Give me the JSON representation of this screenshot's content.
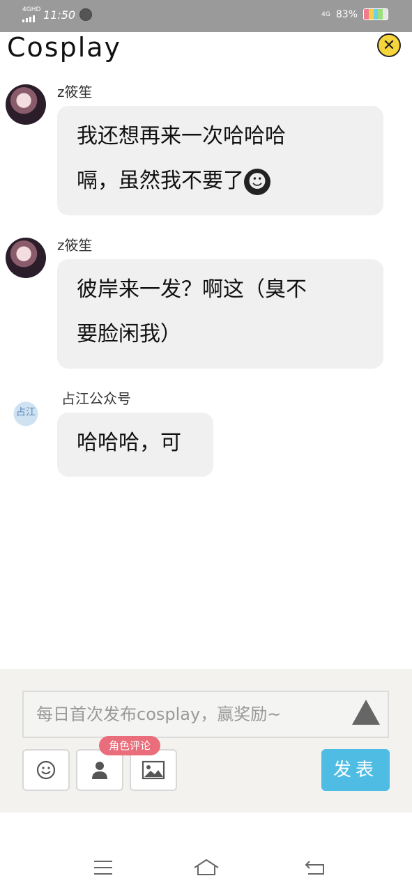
{
  "status_bar": {
    "network": "4GHD",
    "time": "11:50",
    "signal_right": "4G",
    "battery_percent": "83%",
    "battery_colors": [
      "#f27a8f",
      "#f7cf4b",
      "#6fd0e6",
      "#9be07a"
    ]
  },
  "header": {
    "title": "Cosplay",
    "close_icon": "close-icon",
    "close_glyph": "✕"
  },
  "messages": [
    {
      "sender": "z筱笙",
      "avatar": "girl-portrait",
      "lines": [
        "我还想再来一次哈哈哈",
        "嗝，虽然我不要了"
      ],
      "emoji": "☻"
    },
    {
      "sender": "z筱笙",
      "avatar": "girl-portrait",
      "lines": [
        "彼岸来一发？啊这（臭不",
        "要脸闲我）"
      ]
    },
    {
      "sender": "占江公众号",
      "avatar": "logo",
      "avatar_text": "占江",
      "lines": [
        "哈哈哈，可"
      ]
    }
  ],
  "composer": {
    "placeholder": "每日首次发布cosplay，赢奖励~",
    "role_badge": "角色评论",
    "publish_label": "发表",
    "tools": [
      "smiley-icon",
      "person-icon",
      "image-icon"
    ]
  },
  "navbar": {
    "icons": [
      "menu-icon",
      "home-icon",
      "back-icon"
    ]
  }
}
